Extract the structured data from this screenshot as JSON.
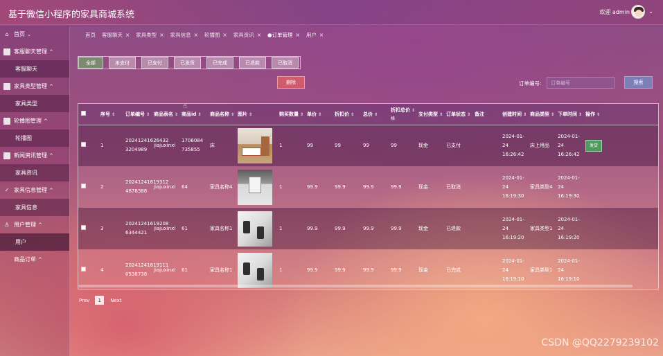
{
  "header": {
    "title": "基于微信小程序的家具商城系统",
    "welcome": "欢迎 admin",
    "caret": "⌄"
  },
  "sidebar": {
    "groups": [
      {
        "icon": "home-icon",
        "label": "首页",
        "subs": []
      },
      {
        "icon": "box-icon",
        "label": "客服聊天管理",
        "subs": [
          "客服聊天"
        ]
      },
      {
        "icon": "box-icon",
        "label": "家具类型管理",
        "subs": [
          "家具类型"
        ]
      },
      {
        "icon": "box-icon",
        "label": "轮播图管理",
        "subs": [
          "轮播图"
        ]
      },
      {
        "icon": "box-icon",
        "label": "新闻资讯管理",
        "subs": [
          "家具资讯"
        ]
      },
      {
        "icon": "check-circle-icon",
        "label": "家具信息管理",
        "subs": [
          "家具信息"
        ]
      },
      {
        "icon": "user-icon",
        "label": "用户管理",
        "subs": [
          "用户"
        ]
      },
      {
        "icon": "",
        "label": "商品订单",
        "subs": []
      }
    ]
  },
  "tabs": [
    {
      "label": "首页",
      "closable": false
    },
    {
      "label": "客服聊天",
      "closable": true
    },
    {
      "label": "家具类型",
      "closable": true
    },
    {
      "label": "家具信息",
      "closable": true
    },
    {
      "label": "轮播图",
      "closable": true
    },
    {
      "label": "家具资讯",
      "closable": true
    },
    {
      "label": "●订单管理",
      "closable": true
    },
    {
      "label": "用户",
      "closable": true
    }
  ],
  "filters": [
    "全部",
    "未支付",
    "已支付",
    "已发货",
    "已完成",
    "已退款",
    "已取消"
  ],
  "actions": {
    "delete": "删除",
    "search_label": "订单编号:",
    "search_placeholder": "订单编号",
    "search_button": "搜索"
  },
  "table": {
    "columns": [
      "序号",
      "订单编号",
      "商品表名",
      "商品id",
      "商品名称",
      "图片",
      "购买数量",
      "单价",
      "折扣价",
      "总价",
      "折扣总价",
      "支付类型",
      "订单状态",
      "备注",
      "创建时间",
      "商品类型",
      "下单时间",
      "操作"
    ],
    "column_sub": {
      "10": "格"
    },
    "rows": [
      {
        "no": "1",
        "order": "20241241626432 3204989",
        "table": "jiajuxinxi",
        "goodsid": "1706084 735855",
        "name": "床",
        "qty": "1",
        "price": "99",
        "discount": "99",
        "total": "99",
        "disc_total": "99",
        "pay": "现金",
        "status": "已支付",
        "remark": "",
        "created": "2024-01-24 16:26:42",
        "type": "床上用品",
        "ordered": "2024-01-24 16:26:42",
        "op": "发货"
      },
      {
        "no": "2",
        "order": "20241241619312 4878388",
        "table": "jiajuxinxi",
        "goodsid": "64",
        "name": "家具名称4",
        "qty": "1",
        "price": "99.9",
        "discount": "99.9",
        "total": "99.9",
        "disc_total": "99.9",
        "pay": "现金",
        "status": "已取消",
        "remark": "",
        "created": "2024-01-24 16:19:30",
        "type": "家具类型4",
        "ordered": "2024-01-24 16:19:30",
        "op": ""
      },
      {
        "no": "3",
        "order": "20241241619208 6344421",
        "table": "jiajuxinxi",
        "goodsid": "61",
        "name": "家具名称1",
        "qty": "1",
        "price": "99.9",
        "discount": "99.9",
        "total": "99.9",
        "disc_total": "99.9",
        "pay": "现金",
        "status": "已退款",
        "remark": "",
        "created": "2024-01-24 16:19:20",
        "type": "家具类型1",
        "ordered": "2024-01-24 16:19:20",
        "op": ""
      },
      {
        "no": "4",
        "order": "20241241619111 0538738",
        "table": "jiajuxinxi",
        "goodsid": "61",
        "name": "家具名称1",
        "qty": "1",
        "price": "99.9",
        "discount": "99.9",
        "total": "99.9",
        "disc_total": "99.9",
        "pay": "现金",
        "status": "已完成",
        "remark": "",
        "created": "2024-01-24 16:19:10",
        "type": "家具类型1",
        "ordered": "2024-01-24 16:19:10",
        "op": ""
      }
    ]
  },
  "pagination": {
    "prev": "Prev",
    "current": "1",
    "next": "Next"
  },
  "watermark": "CSDN @QQ2279239102"
}
